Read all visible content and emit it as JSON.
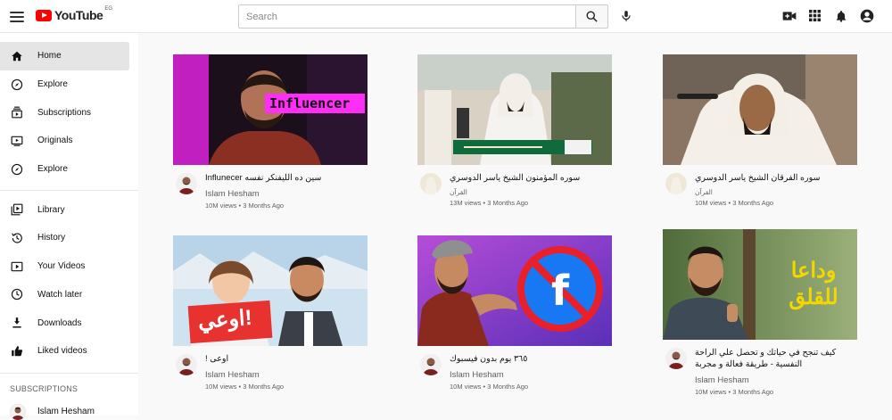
{
  "header": {
    "logo_text": "YouTube",
    "logo_region": "EG",
    "search_placeholder": "Search"
  },
  "icons": {
    "menu": "hamburger-icon",
    "search": "search-icon",
    "mic": "microphone-icon",
    "create": "video-camera-icon",
    "apps": "apps-grid-icon",
    "notifications": "bell-icon",
    "account": "account-circle-icon"
  },
  "colors": {
    "brand_red": "#ff0000",
    "background": "#f9f9f9",
    "active_nav": "#e5e5e5",
    "secondary_text": "#606060"
  },
  "sidebar": {
    "primary": [
      {
        "label": "Home",
        "icon": "home-icon",
        "active": true
      },
      {
        "label": "Explore",
        "icon": "compass-icon"
      },
      {
        "label": "Subscriptions",
        "icon": "subscriptions-icon"
      },
      {
        "label": "Originals",
        "icon": "originals-icon"
      },
      {
        "label": "Explore",
        "icon": "compass-icon"
      }
    ],
    "secondary": [
      {
        "label": "Library",
        "icon": "library-icon"
      },
      {
        "label": "History",
        "icon": "history-icon"
      },
      {
        "label": "Your Videos",
        "icon": "your-videos-icon"
      },
      {
        "label": "Watch later",
        "icon": "clock-icon"
      },
      {
        "label": "Downloads",
        "icon": "download-icon"
      },
      {
        "label": "Liked videos",
        "icon": "thumbs-up-icon"
      }
    ],
    "subscriptions_heading": "SUBSCRIPTIONS",
    "subscriptions": [
      {
        "label": "Islam Hesham"
      }
    ]
  },
  "videos": [
    {
      "title": "سين ده الليفنكر نفسه Influnecer",
      "channel": "Islam Hesham",
      "stats": "10M views • 3 Months Ago",
      "thumb_text": "Influencer"
    },
    {
      "title": "سوره المؤمنون الشيخ ياسر الدوسري",
      "channel": "القرآن",
      "stats": "13M views • 3 Months Ago"
    },
    {
      "title": "سوره الفرقان الشيخ ياسر الدوسري",
      "channel": "القرآن",
      "stats": "10M views • 3 Months Ago"
    },
    {
      "title": "اوعى !",
      "channel": "Islam Hesham",
      "stats": "10M views • 3 Months Ago",
      "thumb_text": "اوعي!"
    },
    {
      "title": "٣٦٥ يوم بدون فيسبوك",
      "channel": "Islam Hesham",
      "stats": "10M views • 3 Months Ago"
    },
    {
      "title": "كيف تنجح في حياتك و تحصل علي الراحة النفسية - طريقة فعالة و مجربة",
      "channel": "Islam Hesham",
      "stats": "10M views • 3 Months Ago",
      "thumb_text": "وداعا للقلق"
    }
  ]
}
